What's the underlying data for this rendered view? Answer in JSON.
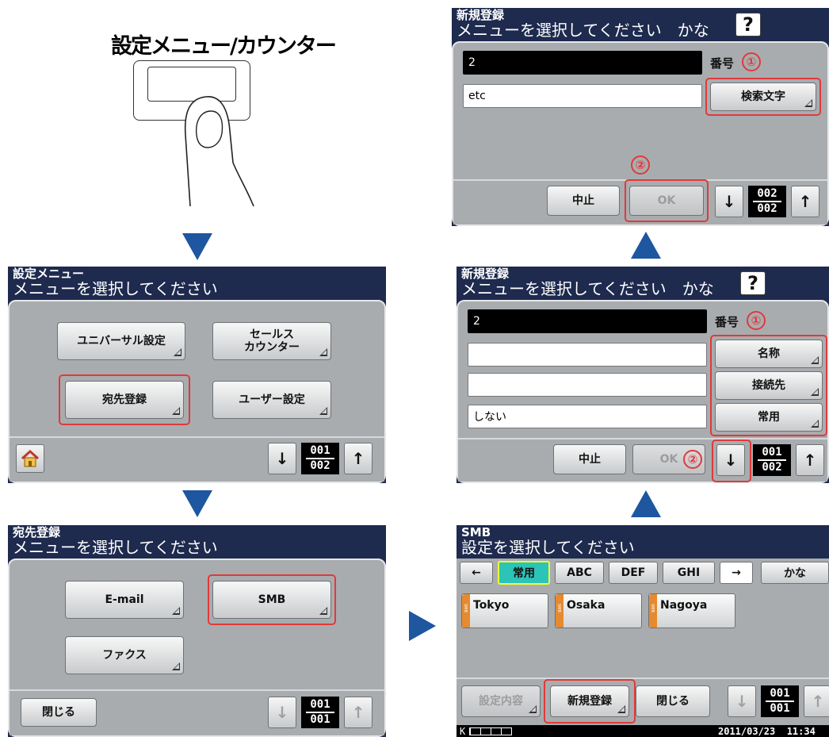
{
  "device_illustration": {
    "label": "設定メニュー/カウンター"
  },
  "panel1": {
    "header_sub": "設定メニュー",
    "header_main": "メニューを選択してください",
    "buttons": {
      "universal": "ユニバーサル設定",
      "sales_line1": "セールス",
      "sales_line2": "カウンター",
      "address": "宛先登録",
      "user": "ユーザー設定"
    },
    "arrows": {
      "down": "↓",
      "up": "↑"
    },
    "page": {
      "current": "001",
      "total": "002"
    }
  },
  "panel2": {
    "header_sub": "宛先登録",
    "header_main": "メニューを選択してください",
    "buttons": {
      "email": "E-mail",
      "smb": "SMB",
      "fax": "ファクス",
      "close": "閉じる"
    },
    "arrows": {
      "down": "↓",
      "up": "↑"
    },
    "page": {
      "current": "001",
      "total": "001"
    }
  },
  "panel3": {
    "header_sub": "SMB",
    "header_main": "設定を選択してください",
    "tabs": {
      "left": "←",
      "common": "常用",
      "abc": "ABC",
      "def": "DEF",
      "ghi": "GHI",
      "right": "→",
      "kana": "かな"
    },
    "destinations": [
      "Tokyo",
      "Osaka",
      "Nagoya"
    ],
    "buttons": {
      "settings": "設定内容",
      "new": "新規登録",
      "close": "閉じる"
    },
    "arrows": {
      "down": "↓",
      "up": "↑"
    },
    "page": {
      "current": "001",
      "total": "001"
    },
    "status": {
      "counter": "K",
      "datetime": "2011/03/23  11:34"
    }
  },
  "panel4": {
    "header_sub": "新規登録",
    "header_main": "メニューを選択してください　かな",
    "help": "?",
    "number_value": "2",
    "number_label": "番号",
    "marker1": "①",
    "marker2": "②",
    "buttons": {
      "name": "名称",
      "connect": "接続先",
      "common": "常用",
      "cancel": "中止",
      "ok": "OK"
    },
    "field_common_value": "しない",
    "arrows": {
      "down": "↓",
      "up": "↑"
    },
    "page": {
      "current": "001",
      "total": "002"
    }
  },
  "panel5": {
    "header_sub": "新規登録",
    "header_main": "メニューを選択してください　かな",
    "help": "?",
    "number_value": "2",
    "number_label": "番号",
    "marker1": "①",
    "marker2": "②",
    "search_value": "etc",
    "buttons": {
      "search": "検索文字",
      "cancel": "中止",
      "ok": "OK"
    },
    "arrows": {
      "down": "↓",
      "up": "↑"
    },
    "page": {
      "current": "002",
      "total": "002"
    }
  }
}
